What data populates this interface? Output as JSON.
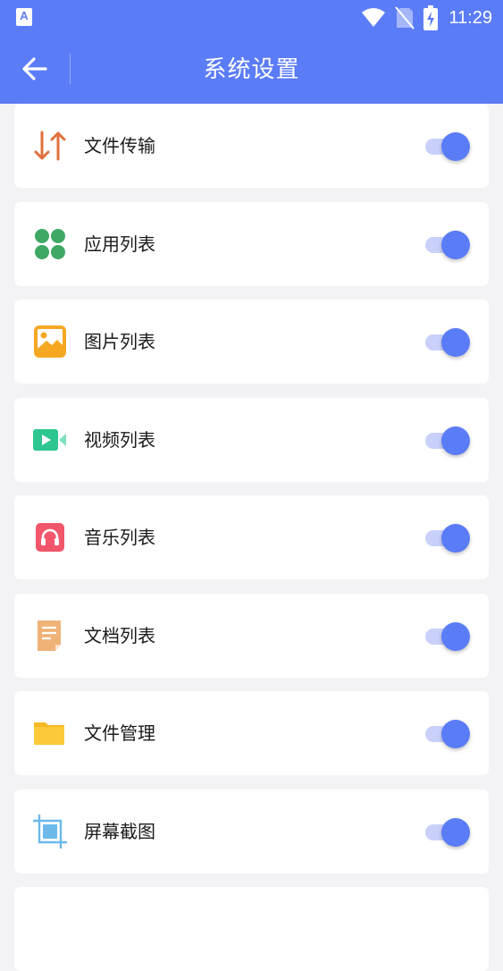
{
  "status_bar": {
    "app_badge": "A",
    "time": "11:29"
  },
  "toolbar": {
    "title": "系统设置",
    "back_icon": "arrow-left-icon"
  },
  "settings": [
    {
      "label": "文件传输",
      "icon": "file-transfer-icon",
      "enabled": true
    },
    {
      "label": "应用列表",
      "icon": "apps-grid-icon",
      "enabled": true
    },
    {
      "label": "图片列表",
      "icon": "image-icon",
      "enabled": true
    },
    {
      "label": "视频列表",
      "icon": "video-icon",
      "enabled": true
    },
    {
      "label": "音乐列表",
      "icon": "headphones-icon",
      "enabled": true
    },
    {
      "label": "文档列表",
      "icon": "document-icon",
      "enabled": true
    },
    {
      "label": "文件管理",
      "icon": "folder-icon",
      "enabled": true
    },
    {
      "label": "屏幕截图",
      "icon": "screenshot-crop-icon",
      "enabled": true
    }
  ],
  "colors": {
    "accent": "#5b7cf7",
    "switch_track": "#c9d1fb",
    "background": "#f3f3f5",
    "transfer_icon": "#e0703e",
    "apps_icon": "#3fa864",
    "image_icon": "#f7a823",
    "video_icon": "#2ec68f",
    "music_icon": "#f2566b",
    "doc_icon": "#efb277",
    "folder_icon": "#f7b825",
    "screenshot_icon": "#6cb9ea"
  }
}
